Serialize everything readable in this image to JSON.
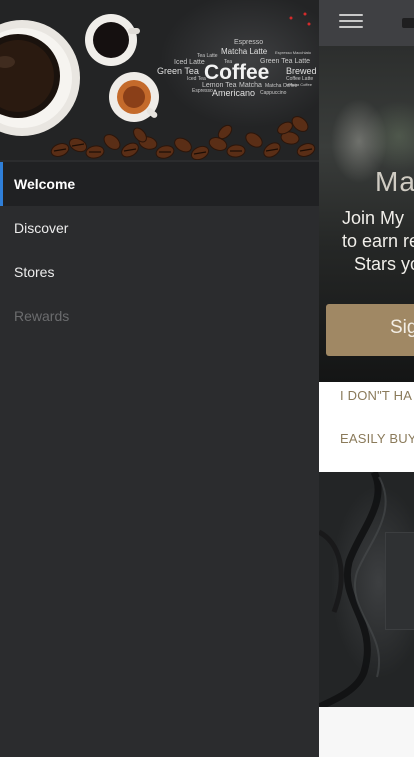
{
  "drawer": {
    "header": {
      "word_cloud": {
        "main": "Coffee",
        "words": [
          "Espresso",
          "Matcha Latte",
          "Tea Latte",
          "Iced Latte",
          "Tea",
          "Green Tea Latte",
          "Green Tea",
          "Brewed",
          "Iced Tea",
          "Lemon Tea",
          "Matcha",
          "Americano",
          "Espresso",
          "Matcha Coffee",
          "Cappuccino",
          "Coffee Latte",
          "Espresso Macchiato",
          "Matcha Coffee"
        ]
      }
    },
    "menu": [
      {
        "label": "Welcome",
        "state": "active"
      },
      {
        "label": "Discover",
        "state": "normal"
      },
      {
        "label": "Stores",
        "state": "normal"
      },
      {
        "label": "Rewards",
        "state": "disabled"
      }
    ]
  },
  "main": {
    "hero": {
      "title": "Ma",
      "text_lines": [
        "Join My",
        "to earn re",
        "Stars yo"
      ],
      "signin_label": "Sig"
    },
    "info": {
      "line1": "I DON\"T HA",
      "line2": "EASILY BUY"
    }
  },
  "colors": {
    "accent": "#2f7fd9",
    "button": "#a08864",
    "drawer_bg": "#2b2c2e",
    "active_bg": "#202123"
  },
  "icons": {
    "menu": "hamburger-icon"
  }
}
